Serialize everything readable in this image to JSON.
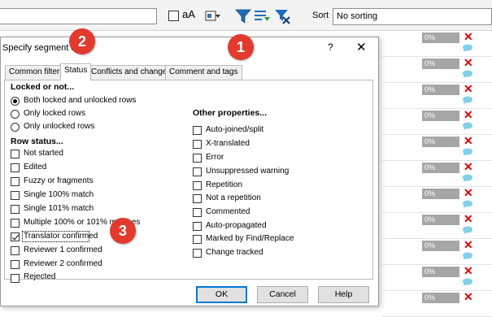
{
  "toolbar": {
    "aa_label": "aA",
    "sort_label": "Sort",
    "sort_value": "No sorting"
  },
  "grid": {
    "rows": [
      {
        "progress": "0%"
      },
      {
        "progress": "0%"
      },
      {
        "progress": "0%"
      },
      {
        "progress": "0%"
      },
      {
        "progress": "0%"
      },
      {
        "progress": "0%"
      },
      {
        "progress": "0%"
      },
      {
        "progress": "0%"
      },
      {
        "progress": "0%"
      },
      {
        "progress": "0%"
      },
      {
        "progress": "0%"
      }
    ]
  },
  "dialog": {
    "title": "Specify segment sta",
    "help": "?",
    "close": "✕",
    "tabs": [
      "Common filters",
      "Status",
      "Conflicts and changes",
      "Comment and tags"
    ],
    "locked_heading": "Locked or not...",
    "locked_options": [
      "Both locked and unlocked rows",
      "Only locked rows",
      "Only unlocked rows"
    ],
    "row_status_heading": "Row status...",
    "row_status_options": [
      "Not started",
      "Edited",
      "Fuzzy or fragments",
      "Single 100% match",
      "Single 101% match",
      "Multiple 100% or 101% matches",
      "Translator confirmed",
      "Reviewer 1 confirmed",
      "Reviewer 2 confirmed",
      "Rejected"
    ],
    "other_heading": "Other properties...",
    "other_options": [
      "Auto-joined/split",
      "X-translated",
      "Error",
      "Unsuppressed warning",
      "Repetition",
      "Not a repetition",
      "Commented",
      "Auto-propagated",
      "Marked by Find/Replace",
      "Change tracked"
    ],
    "buttons": {
      "ok": "OK",
      "cancel": "Cancel",
      "help": "Help"
    }
  },
  "callouts": [
    "1",
    "2",
    "3"
  ],
  "colors": {
    "callout": "#e23a2d",
    "accent": "#0078d7",
    "delete": "#e00000",
    "comment": "#7fd0e8"
  }
}
